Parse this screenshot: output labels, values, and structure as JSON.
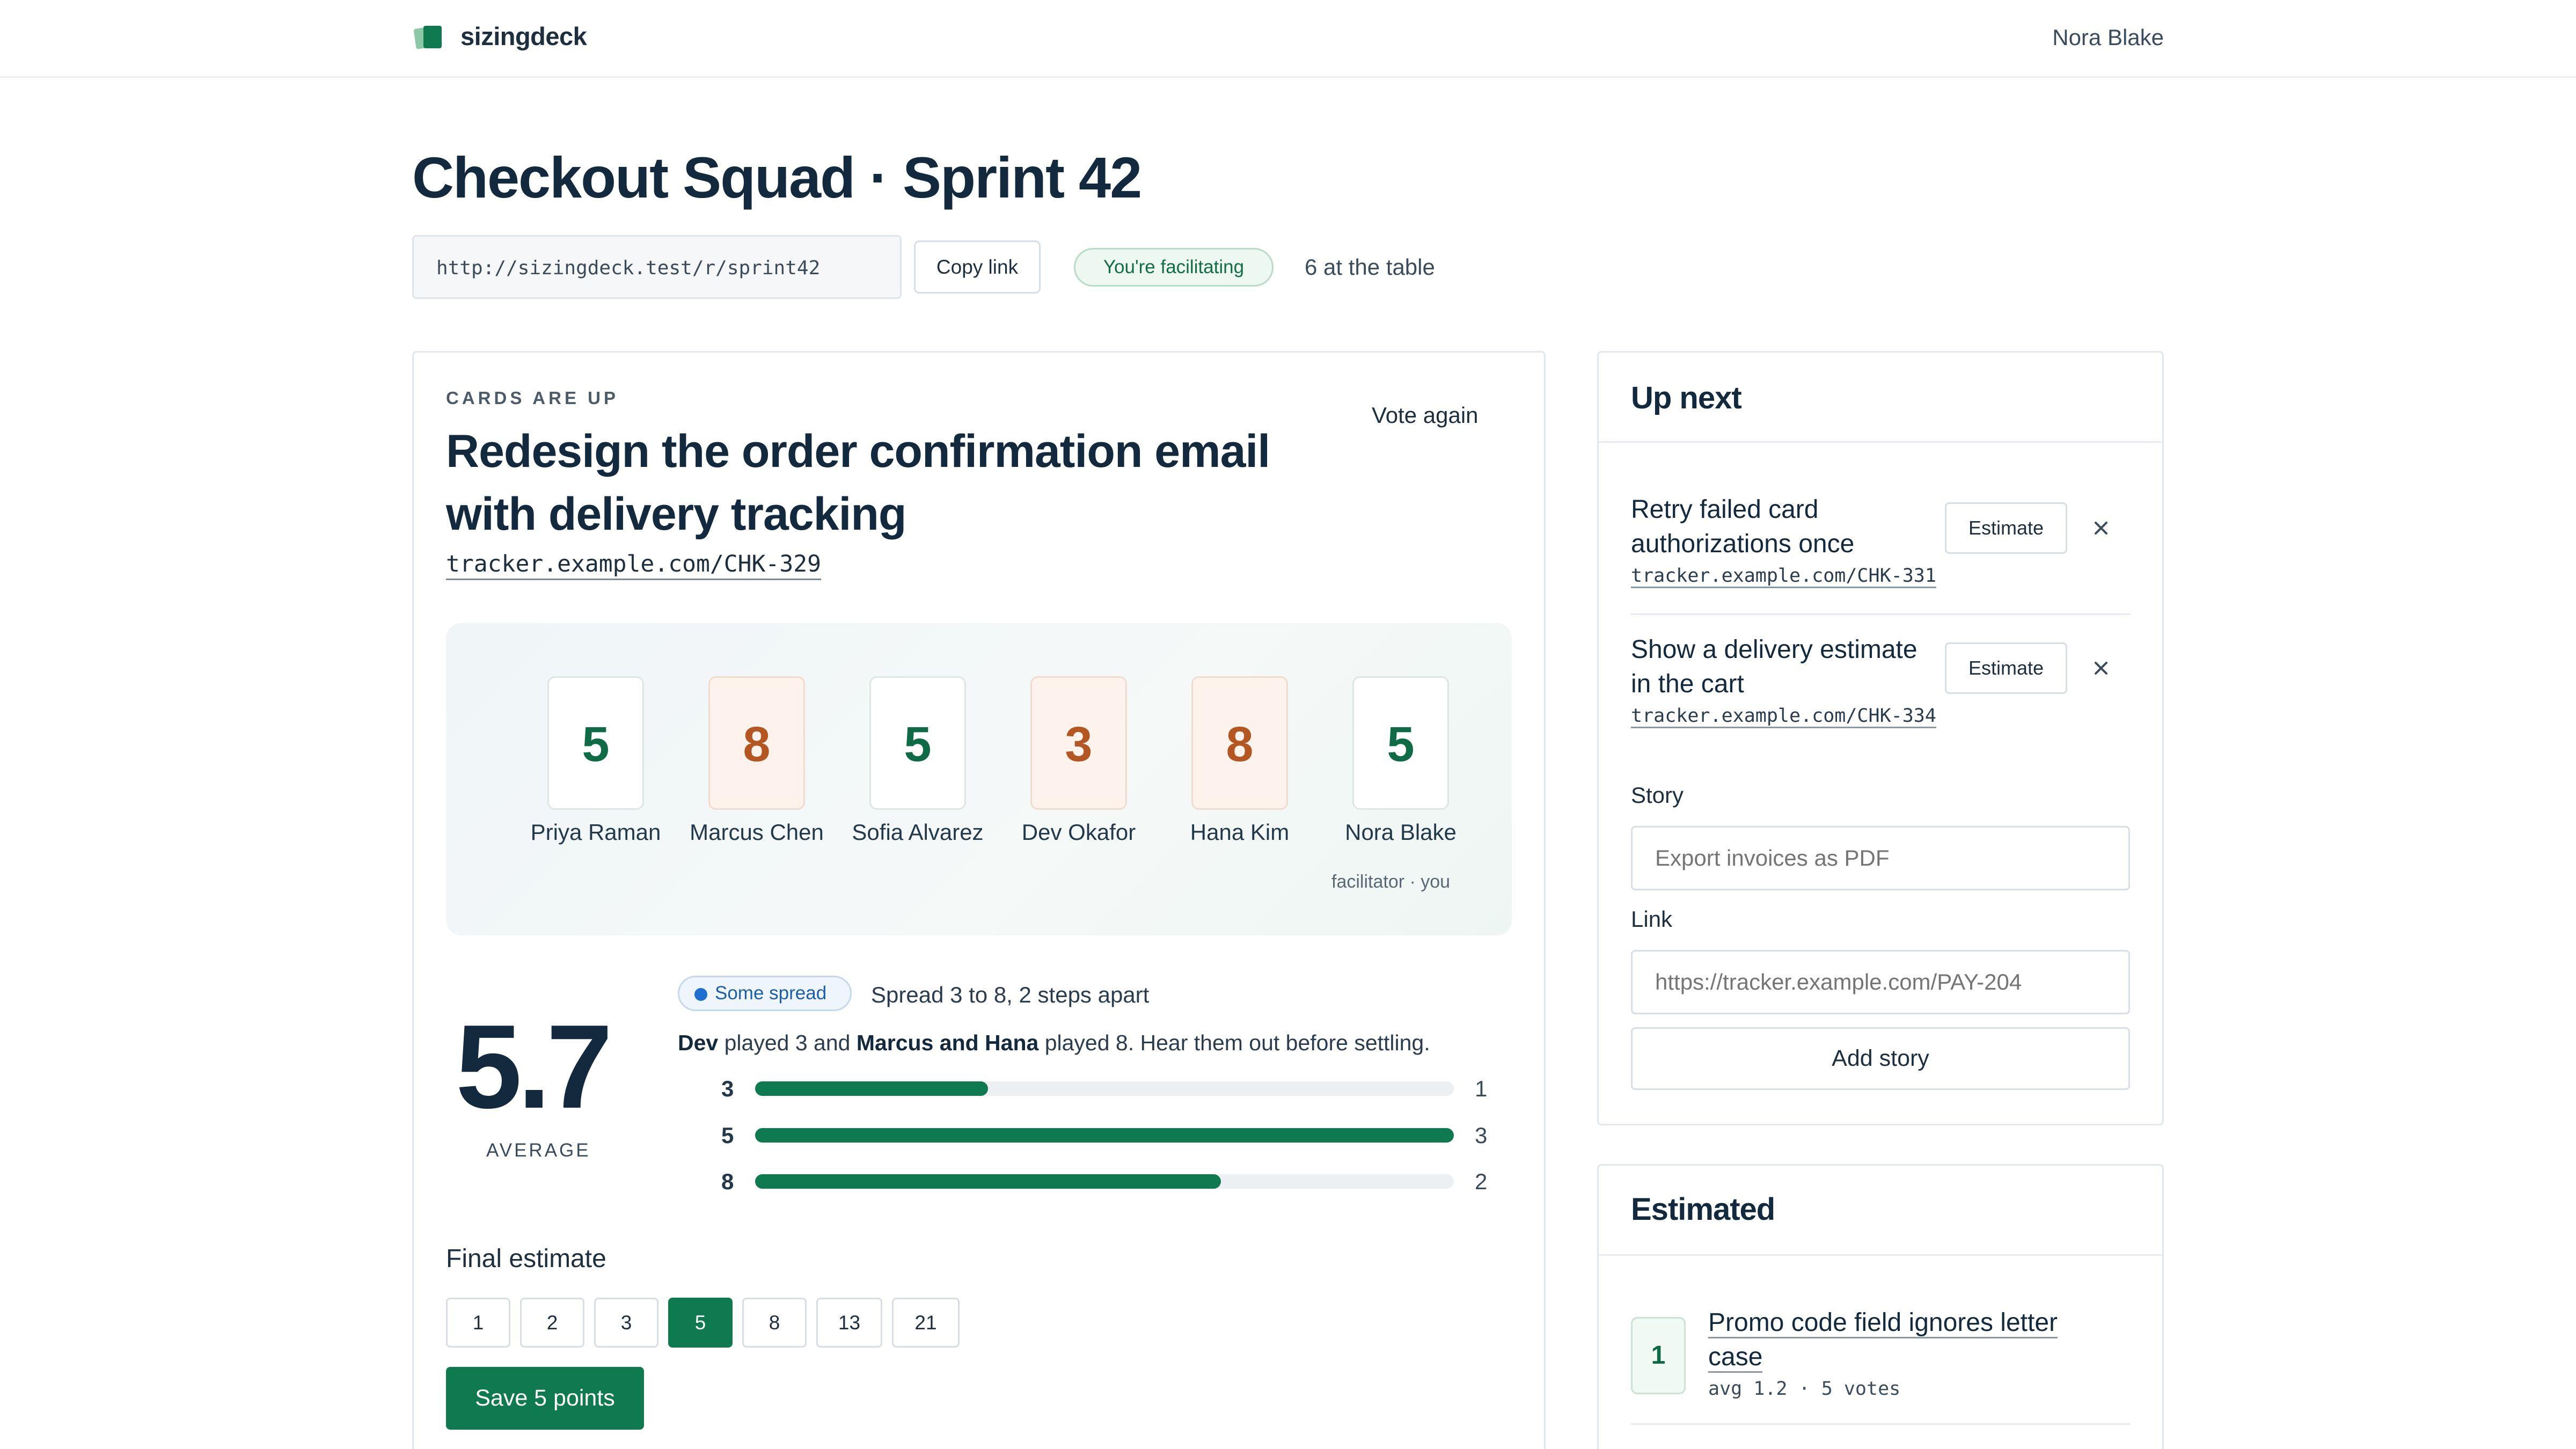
{
  "app": {
    "brand": "sizingdeck",
    "user": "Nora Blake"
  },
  "session": {
    "title": "Checkout Squad · Sprint 42",
    "room_link": "http://sizingdeck.test/r/sprint42",
    "copy_link_label": "Copy link",
    "facilitating_badge": "You're facilitating",
    "table_count": "6 at the table"
  },
  "current": {
    "status": "CARDS ARE UP",
    "vote_again_label": "Vote again",
    "story_title": "Redesign the order confirmation email with delivery tracking",
    "story_link": "tracker.example.com/CHK-329",
    "votes": [
      {
        "name": "Priya Raman",
        "value": "5",
        "tone": "mid"
      },
      {
        "name": "Marcus Chen",
        "value": "8",
        "tone": "hi"
      },
      {
        "name": "Sofia Alvarez",
        "value": "5",
        "tone": "mid"
      },
      {
        "name": "Dev Okafor",
        "value": "3",
        "tone": "hi"
      },
      {
        "name": "Hana Kim",
        "value": "8",
        "tone": "hi"
      },
      {
        "name": "Nora Blake",
        "value": "5",
        "tone": "mid"
      }
    ],
    "facilitator_note": "facilitator · you",
    "average": "5.7",
    "average_label": "AVERAGE",
    "spread_badge": "Some spread",
    "spread_text": "Spread 3 to 8, 2 steps apart",
    "spread_detail": {
      "p1": "Dev",
      "t1": " played 3 and ",
      "p2": "Marcus and Hana",
      "t2": " played 8. Hear them out before settling."
    },
    "distribution": [
      {
        "value": "3",
        "count": 1
      },
      {
        "value": "5",
        "count": 3
      },
      {
        "value": "8",
        "count": 2
      }
    ],
    "distribution_max": 3,
    "final_estimate_label": "Final estimate",
    "estimate_options": [
      "1",
      "2",
      "3",
      "5",
      "8",
      "13",
      "21"
    ],
    "selected_estimate": "5",
    "save_label": "Save 5 points"
  },
  "up_next": {
    "title": "Up next",
    "items": [
      {
        "title": "Retry failed card authorizations once",
        "link": "tracker.example.com/CHK-331",
        "button": "Estimate"
      },
      {
        "title": "Show a delivery estimate in the cart",
        "link": "tracker.example.com/CHK-334",
        "button": "Estimate"
      }
    ],
    "story_label": "Story",
    "story_placeholder": "Export invoices as PDF",
    "link_label": "Link",
    "link_placeholder": "https://tracker.example.com/PAY-204",
    "add_label": "Add story"
  },
  "estimated": {
    "title": "Estimated",
    "items": [
      {
        "points": "1",
        "title": "Promo code field ignores letter case",
        "meta": "avg 1.2 · 5 votes"
      }
    ]
  },
  "colors": {
    "accent": "#0f7a4f",
    "warm": "#b35622",
    "ink": "#13293d",
    "info": "#1e6fd0"
  }
}
